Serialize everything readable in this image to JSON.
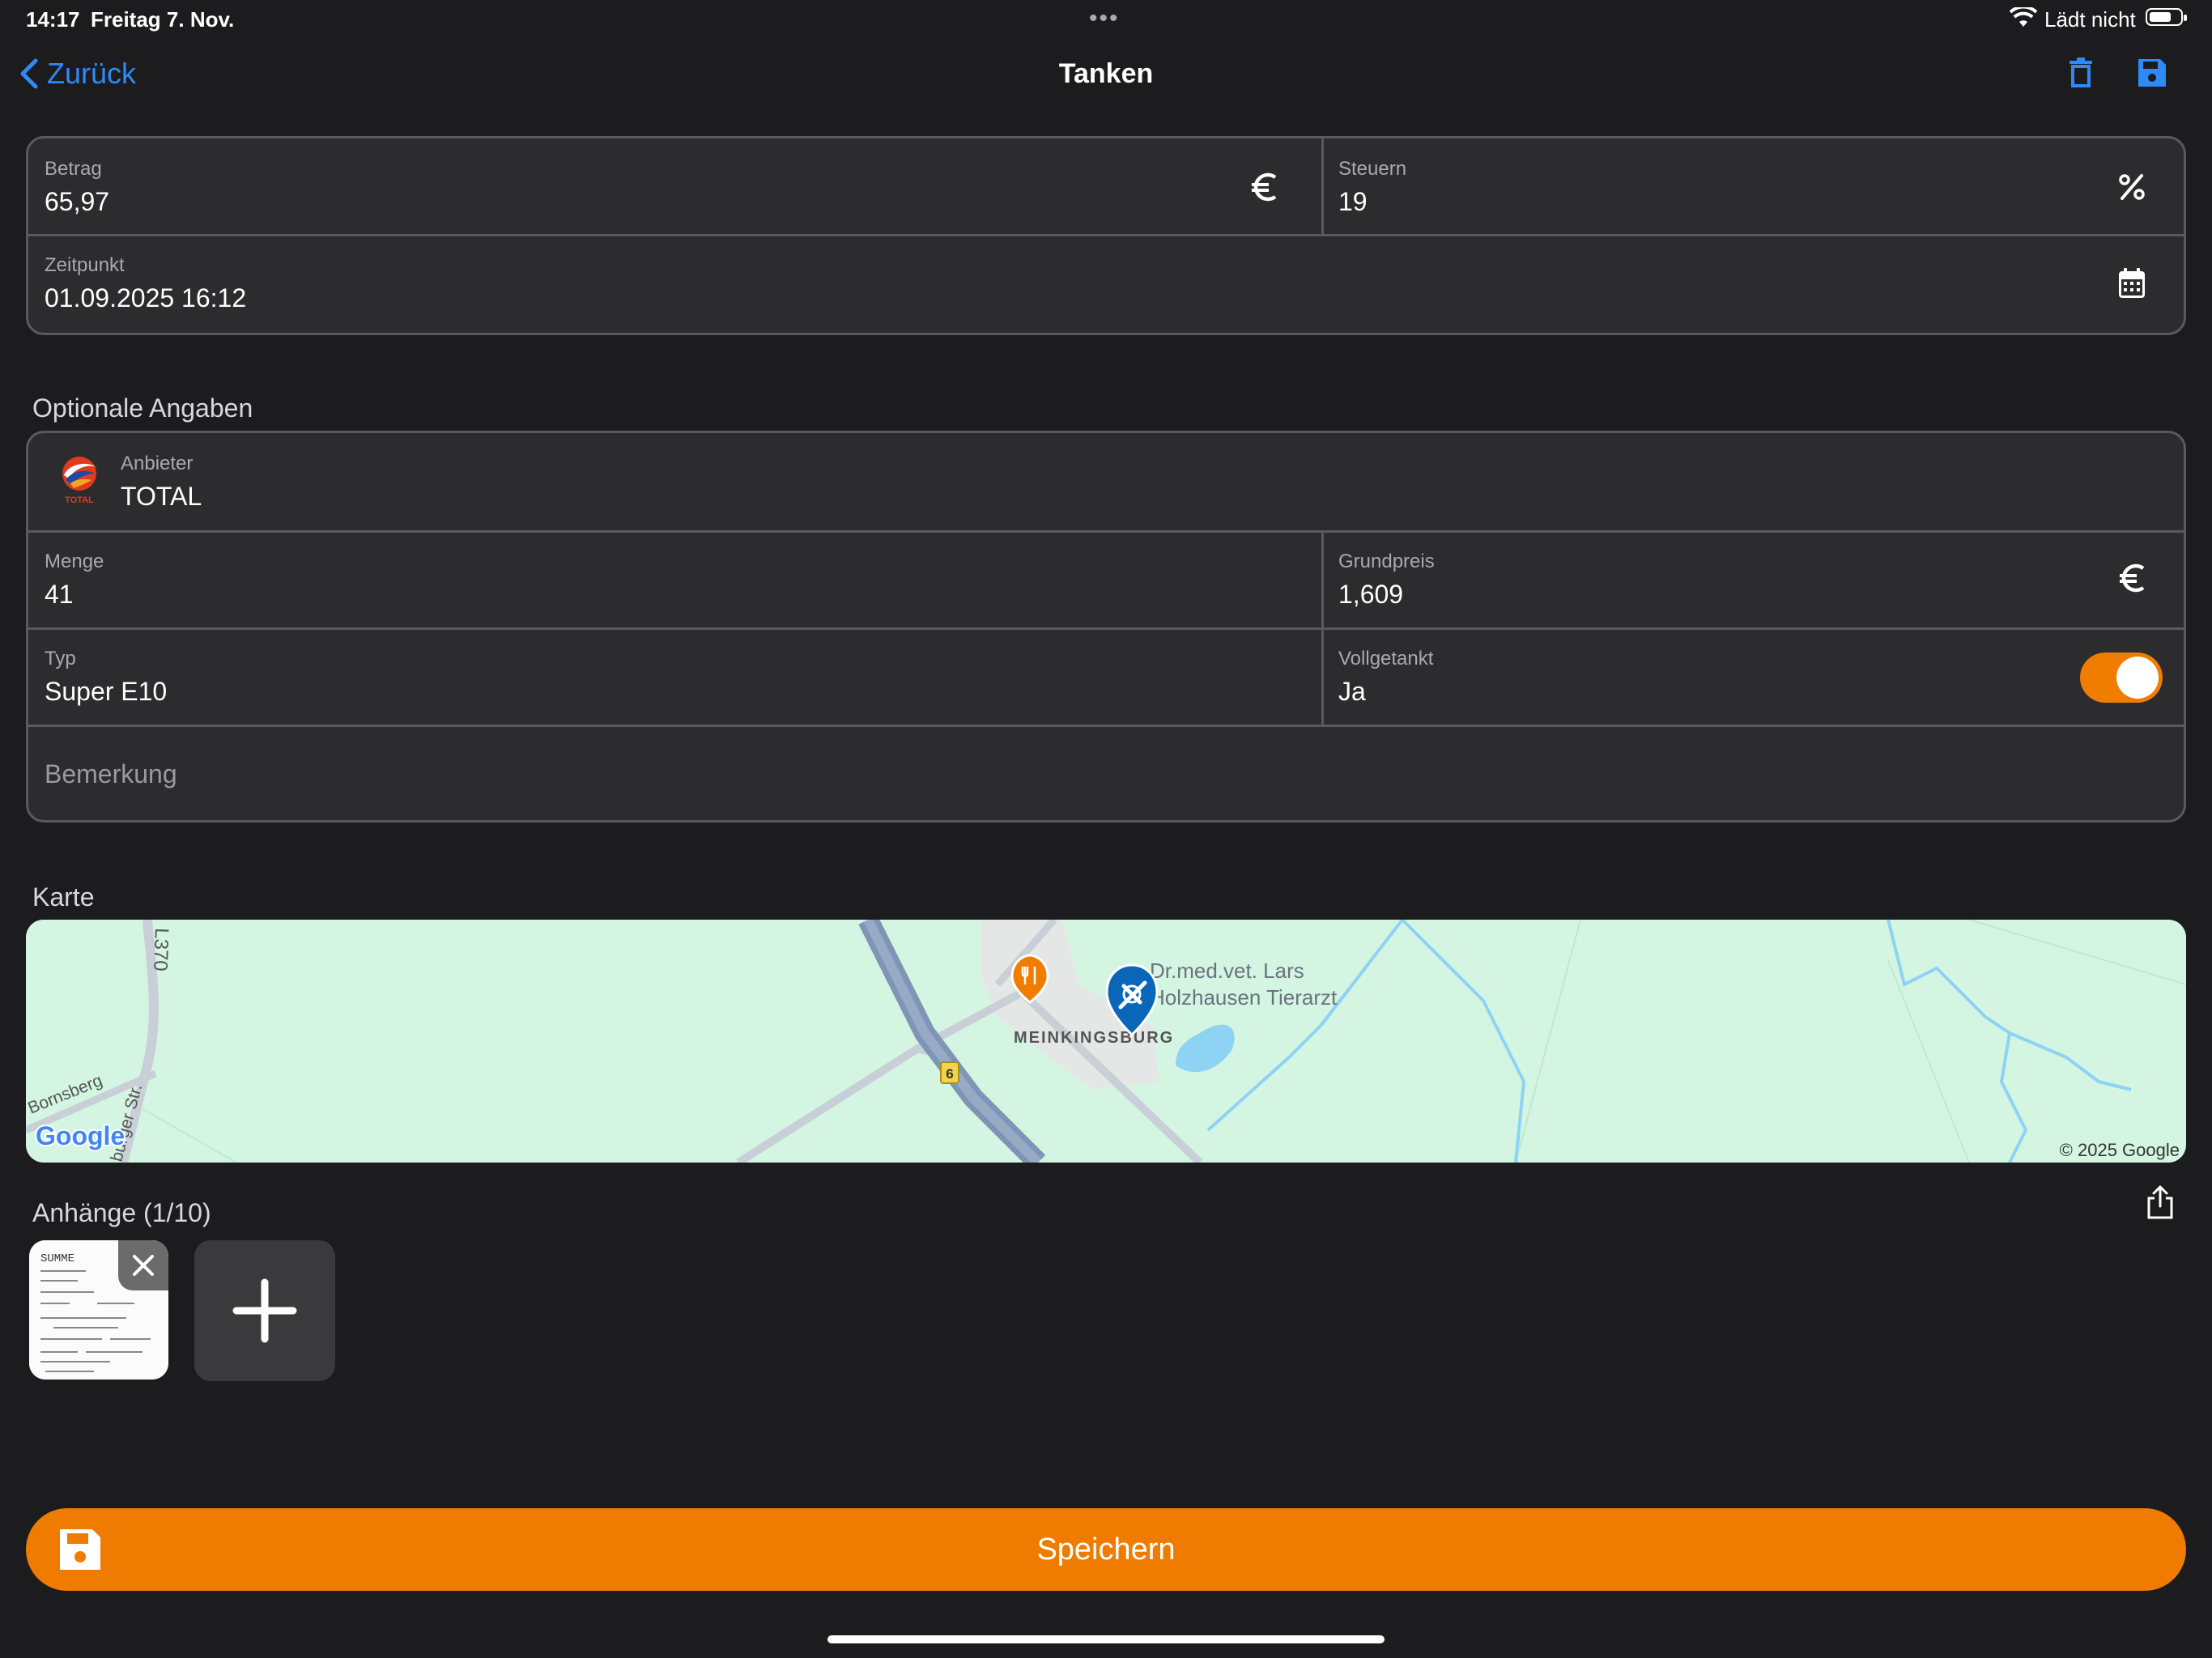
{
  "status_bar": {
    "time": "14:17",
    "date": "Freitag 7. Nov.",
    "charging_text": "Lädt nicht",
    "battery_fraction": 0.75
  },
  "nav": {
    "back_label": "Zurück",
    "title": "Tanken",
    "icons": [
      "chevron-left-icon",
      "trash-icon",
      "save-icon"
    ],
    "accent_color": "#2e8af6"
  },
  "main_form": {
    "betrag": {
      "label": "Betrag",
      "value": "65,97",
      "icon": "euro-icon"
    },
    "steuern": {
      "label": "Steuern",
      "value": "19",
      "icon": "percent-icon"
    },
    "zeitpunkt": {
      "label": "Zeitpunkt",
      "value": "01.09.2025 16:12",
      "icon": "calendar-icon"
    }
  },
  "optional": {
    "section_title": "Optionale Angaben",
    "anbieter": {
      "label": "Anbieter",
      "value": "TOTAL",
      "logo_text": "TOTAL",
      "logo": "total-logo"
    },
    "menge": {
      "label": "Menge",
      "value": "41"
    },
    "grundpreis": {
      "label": "Grundpreis",
      "value": "1,609",
      "icon": "euro-icon"
    },
    "typ": {
      "label": "Typ",
      "value": "Super E10"
    },
    "vollgetankt": {
      "label": "Vollgetankt",
      "value": "Ja",
      "toggle_on": true,
      "toggle_color": "#f07d00"
    },
    "bemerkung": {
      "placeholder": "Bemerkung"
    }
  },
  "map": {
    "section_title": "Karte",
    "road_l370": "L370",
    "road_bornsberg": "Bornsberg",
    "road_burger": "burger Str.",
    "road_badge": "6",
    "place_town": "MEINKINGSBURG",
    "poi_line1": "Dr.med.vet. Lars",
    "poi_line2": "Holzhausen Tierarzt",
    "google_logo": "Google",
    "copyright": "© 2025 Google",
    "land_color": "#d3f5e2",
    "water_color": "#8fd3f4"
  },
  "attachments": {
    "section_title": "Anhänge (1/10)",
    "receipt_header": "SUMME",
    "icons": [
      "share-icon",
      "close-icon",
      "plus-icon"
    ]
  },
  "save_button": {
    "label": "Speichern",
    "color": "#ef7c00",
    "icon": "save-icon"
  }
}
